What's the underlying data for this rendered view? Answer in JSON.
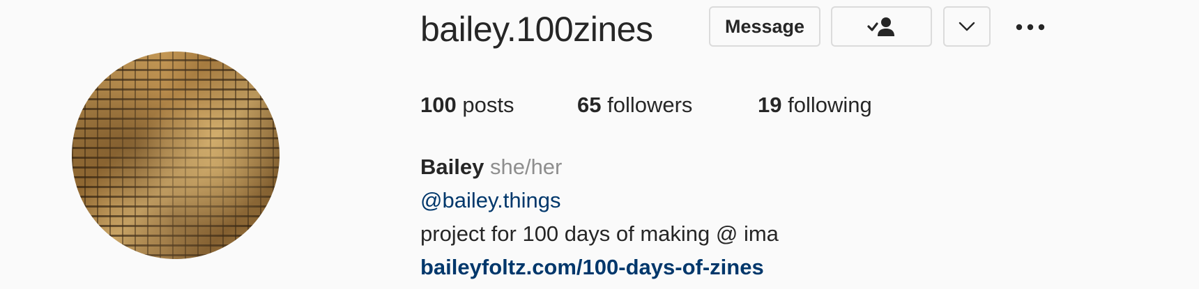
{
  "profile": {
    "username": "bailey.100zines",
    "avatar_icon": "avatar-image"
  },
  "actions": {
    "message_label": "Message",
    "following_icon": "person-check-icon",
    "dropdown_icon": "chevron-down-icon",
    "more_icon": "more-horizontal-icon"
  },
  "stats": {
    "posts_count": "100",
    "posts_label": "posts",
    "followers_count": "65",
    "followers_label": "followers",
    "following_count": "19",
    "following_label": "following"
  },
  "bio": {
    "name": "Bailey",
    "pronouns": "she/her",
    "handle": "@bailey.things",
    "description": "project for 100 days of making @ ima",
    "link": "baileyfoltz.com/100-days-of-zines"
  },
  "colors": {
    "background": "#fafafa",
    "text": "#262626",
    "muted": "#8e8e8e",
    "link": "#00376b",
    "border": "#dbdbdb"
  }
}
